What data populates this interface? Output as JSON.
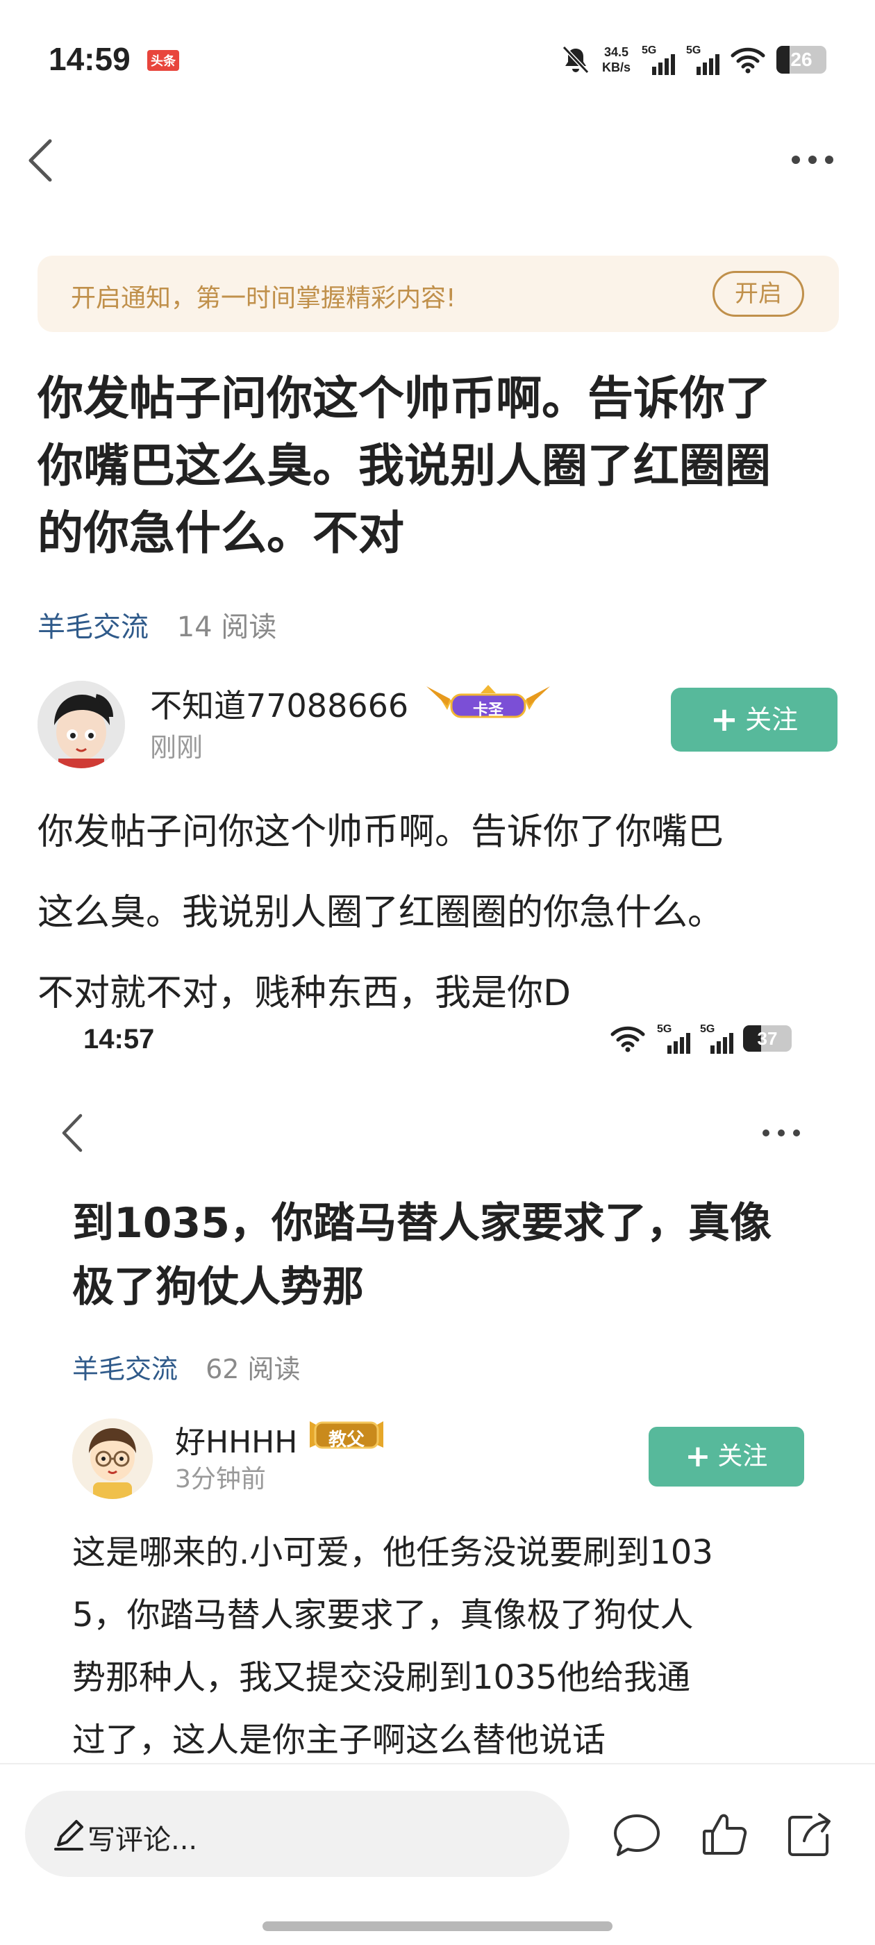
{
  "status_bar": {
    "time": "14:59",
    "app_badge": "头条",
    "net_speed_value": "34.5",
    "net_speed_unit": "KB/s",
    "sim1": "5G",
    "sim2": "5G",
    "battery": "26",
    "battery_level": 0.26,
    "icons": [
      "mute-icon",
      "signal-icon",
      "signal-icon",
      "wifi-icon",
      "battery-icon"
    ]
  },
  "nav": {
    "back_icon": "back-icon",
    "more_icon": "more-icon"
  },
  "notify": {
    "text": "开启通知，第一时间掌握精彩内容!",
    "button": "开启",
    "accent": "#c0904b"
  },
  "post": {
    "title_lines": [
      "你发帖子问你这个帅币啊。告诉你了",
      "你嘴巴这么臭。我说别人圈了红圈圈",
      "的你急什么。不对"
    ],
    "category": "羊毛交流",
    "reads": "14 阅读",
    "author": {
      "name": "不知道77088666",
      "badge": "卡圣",
      "time": "刚刚",
      "follow": "关注"
    },
    "body_lines": [
      "你发帖子问你这个帅币啊。告诉你了你嘴巴",
      "这么臭。我说别人圈了红圈圈的你急什么。",
      "不对就不对，贱种东西，我是你D"
    ]
  },
  "embedded": {
    "status": {
      "time": "14:57",
      "sim1": "5G",
      "sim2": "5G",
      "battery": "37",
      "battery_level": 0.37
    },
    "title_lines": [
      "到1035，你踏马替人家要求了，真像",
      "极了狗仗人势那"
    ],
    "category": "羊毛交流",
    "reads": "62 阅读",
    "author": {
      "name": "好HHHH",
      "badge": "教父",
      "time": "3分钟前",
      "follow": "关注"
    },
    "body_lines": [
      "这是哪来的.小可爱，他任务没说要刷到103",
      "5，你踏马替人家要求了，真像极了狗仗人",
      "势那种人，我又提交没刷到1035他给我通",
      "过了，这人是你主子啊这么替他说话"
    ]
  },
  "bottom_bar": {
    "comment_placeholder": "写评论...",
    "icons": [
      "comment-icon",
      "like-icon",
      "share-icon"
    ]
  },
  "colors": {
    "follow": "#57b99b",
    "category": "#2f5a8a",
    "muted": "#999999"
  }
}
